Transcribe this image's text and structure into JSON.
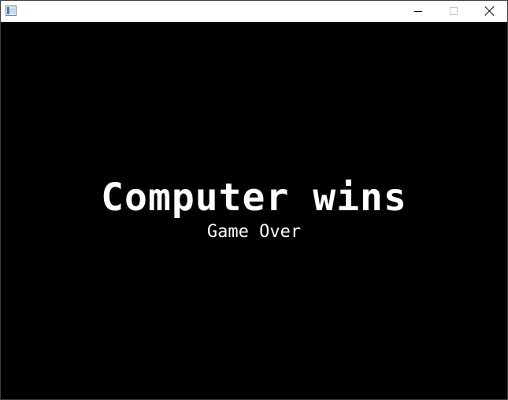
{
  "window": {
    "title": "",
    "icon": "app-window-icon",
    "controls": {
      "minimize_icon": "minimize-icon",
      "maximize_icon": "maximize-icon",
      "close_icon": "close-icon"
    }
  },
  "game": {
    "winner_message": "Computer wins",
    "status_message": "Game Over",
    "background_color": "#000000",
    "text_color": "#ffffff"
  }
}
